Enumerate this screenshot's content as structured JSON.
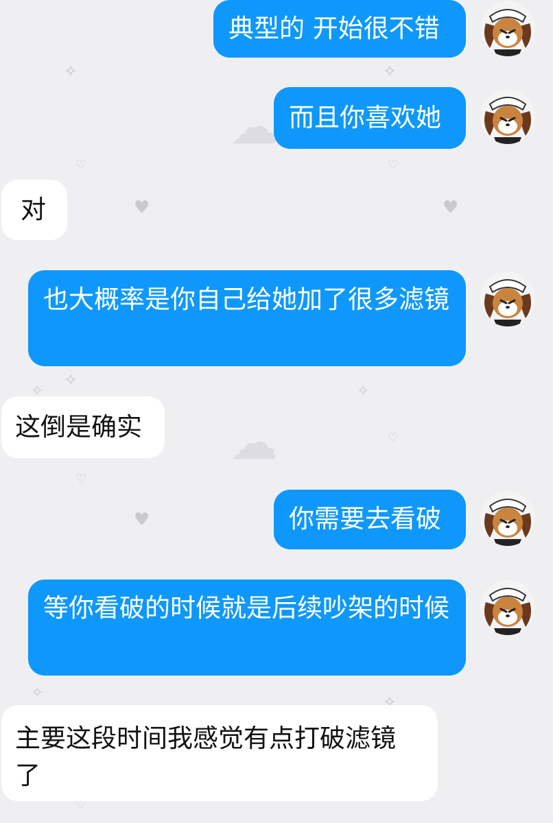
{
  "colors": {
    "background": "#efeff1",
    "outgoing_bubble": "#0e98fb",
    "incoming_bubble": "#ffffff"
  },
  "chat": {
    "messages": [
      {
        "side": "out",
        "text": "典型的 开始很不错",
        "avatar": "maid-puppy-avatar"
      },
      {
        "side": "out",
        "text": "而且你喜欢她",
        "avatar": "maid-puppy-avatar"
      },
      {
        "side": "in",
        "text": "对"
      },
      {
        "side": "out",
        "text": "也大概率是你自己给她加了很多滤镜",
        "avatar": "maid-puppy-avatar"
      },
      {
        "side": "in",
        "text": "这倒是确实"
      },
      {
        "side": "out",
        "text": "你需要去看破",
        "avatar": "maid-puppy-avatar"
      },
      {
        "side": "out",
        "text": "等你看破的时候就是后续吵架的时候",
        "avatar": "maid-puppy-avatar"
      },
      {
        "side": "in",
        "text": "主要这段时间我感觉有点打破滤镜了"
      }
    ]
  },
  "background_decorations": [
    "heart-icon",
    "candy-icon",
    "bunny-icon",
    "sparkle-icon"
  ]
}
